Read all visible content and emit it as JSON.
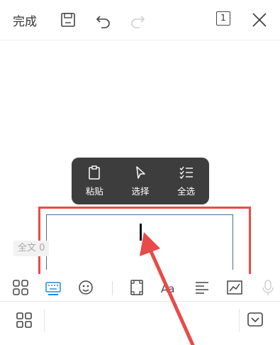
{
  "toolbar": {
    "done_label": "完成",
    "page_count": "1",
    "icons": [
      "save-icon",
      "undo-icon",
      "redo-icon",
      "page-icon",
      "close-icon"
    ]
  },
  "context_menu": {
    "items": [
      {
        "label": "粘贴",
        "icon": "clipboard-icon"
      },
      {
        "label": "选择",
        "icon": "cursor-icon"
      },
      {
        "label": "全选",
        "icon": "checklist-icon"
      }
    ]
  },
  "editor": {
    "word_count_label": "全文 0"
  },
  "format_bar": {
    "icons": [
      "grid-apps-icon",
      "keyboard-icon",
      "emoji-icon",
      "frame-icon",
      "font-icon",
      "align-icon",
      "chart-icon",
      "mic-icon"
    ],
    "font_label": "Aa"
  },
  "colors": {
    "accent": "#1e88e5",
    "highlight_frame": "#e84a4a",
    "menu_bg": "#3d3d3d"
  }
}
